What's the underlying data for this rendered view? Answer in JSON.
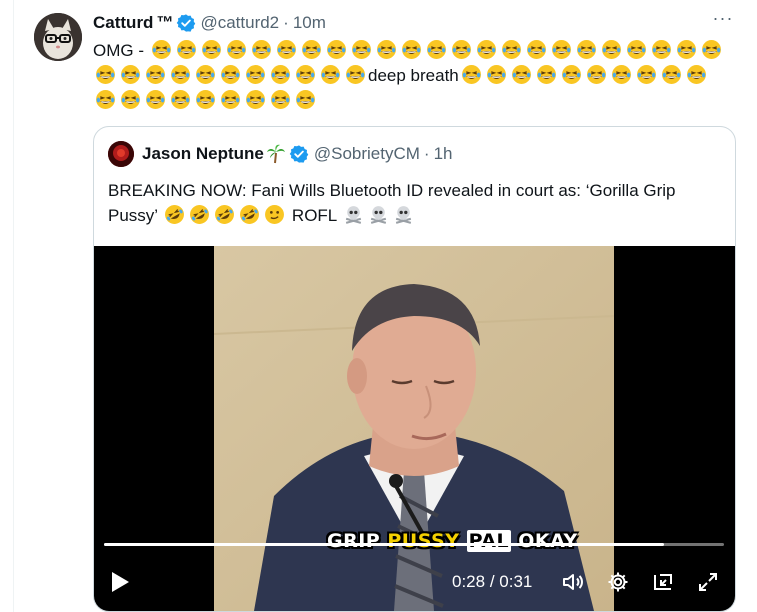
{
  "tweet": {
    "author_name": "Catturd",
    "tm": "™",
    "handle": "@catturd2",
    "time": "10m",
    "separator": "·",
    "text_prefix": "OMG - ",
    "emoji_row1_count": 23,
    "emoji_row2_count": 11,
    "middle_text": "deep breath",
    "emoji_row2b_count": 10,
    "emoji_row3_count": 9,
    "more_label": "···"
  },
  "quote": {
    "author_name": "Jason Neptune",
    "handle": "@SobrietyCM",
    "time": "1h",
    "separator": "·",
    "text": "BREAKING NOW: Fani Wills Bluetooth ID revealed in court as: ‘Gorilla Grip Pussy’",
    "text_suffix": "ROFL",
    "rofl_emoji_count": 4,
    "skull_count": 3
  },
  "video": {
    "caption_word1": "GRIP",
    "caption_word2": "PUSSY",
    "caption_word3": "PAL",
    "caption_word4": "OKAY",
    "current_time": "0:28",
    "duration": "0:31",
    "time_separator": " / ",
    "progress_fraction": 0.903
  },
  "colors": {
    "verified_blue": "#1d9bf0",
    "secondary_text": "#536471",
    "border": "#cfd9de",
    "emoji_yellow": "#f9c623"
  }
}
